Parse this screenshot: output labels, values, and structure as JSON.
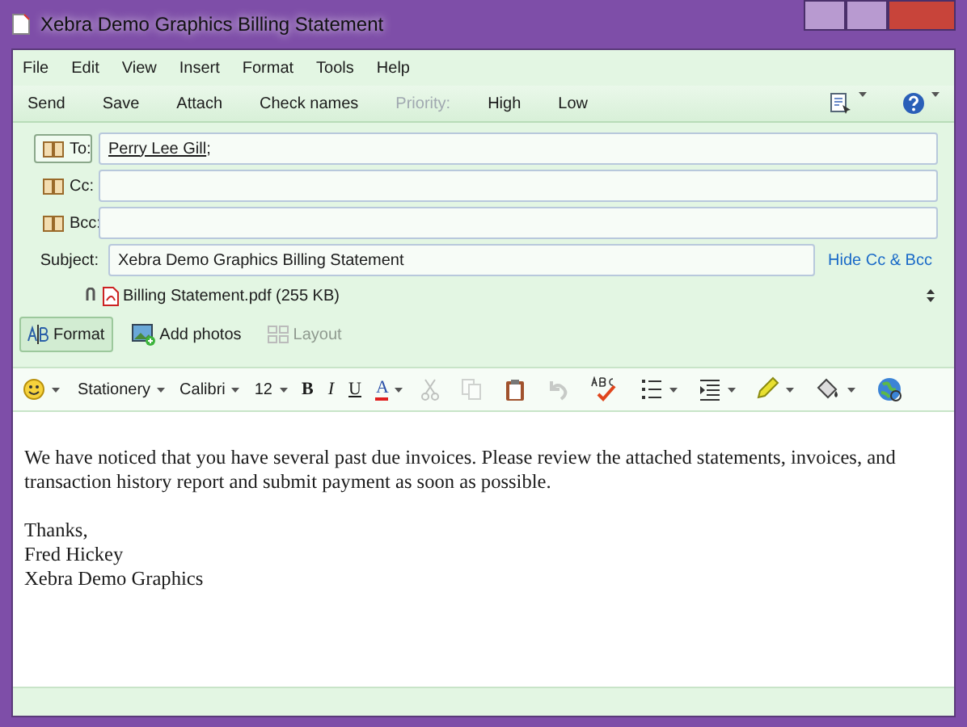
{
  "window": {
    "title": "Xebra Demo Graphics Billing Statement"
  },
  "menu": [
    "File",
    "Edit",
    "View",
    "Insert",
    "Format",
    "Tools",
    "Help"
  ],
  "toolbar": [
    {
      "label": "Send",
      "disabled": false
    },
    {
      "label": "Save",
      "disabled": false
    },
    {
      "label": "Attach",
      "disabled": false
    },
    {
      "label": "Check names",
      "disabled": false
    },
    {
      "label": "Priority:",
      "disabled": true
    },
    {
      "label": "High",
      "disabled": false
    },
    {
      "label": "Low",
      "disabled": false
    }
  ],
  "recipients": [
    {
      "label": "To:",
      "selected": true,
      "value": "Perry Lee Gill",
      "separator": ";"
    },
    {
      "label": "Cc:",
      "selected": false
    },
    {
      "label": "Bcc:",
      "selected": false
    }
  ],
  "subject": {
    "label": "Subject:",
    "value": "Xebra Demo Graphics Billing Statement"
  },
  "hide_link": "Hide Cc & Bcc",
  "attachment": {
    "name": "Billing Statement.pdf (255 KB)"
  },
  "view_buttons": [
    {
      "label": "Format",
      "selected": true,
      "disabled": false
    },
    {
      "label": "Add photos",
      "selected": false,
      "disabled": false
    },
    {
      "label": "Layout",
      "selected": false,
      "disabled": true
    }
  ],
  "format_toolbar": [
    {
      "kind": "icon",
      "disabled": false,
      "dropdown": true
    },
    {
      "kind": "dropdown",
      "label": "Stationery"
    },
    {
      "kind": "dropdown",
      "label": "Calibri"
    },
    {
      "kind": "dropdown",
      "label": "12"
    },
    {
      "kind": "style",
      "label": "B"
    },
    {
      "kind": "style",
      "label": "I"
    },
    {
      "kind": "style",
      "label": "U"
    },
    {
      "kind": "style",
      "label": "A",
      "dropdown": true
    },
    {
      "kind": "icon",
      "disabled": true,
      "dropdown": false
    },
    {
      "kind": "icon",
      "disabled": true,
      "dropdown": false
    },
    {
      "kind": "icon",
      "disabled": false,
      "dropdown": false
    },
    {
      "kind": "icon",
      "disabled": true,
      "dropdown": false
    },
    {
      "kind": "icon",
      "disabled": false,
      "dropdown": false
    },
    {
      "kind": "icon",
      "disabled": false,
      "dropdown": true
    },
    {
      "kind": "icon",
      "disabled": false,
      "dropdown": true
    },
    {
      "kind": "icon",
      "disabled": false,
      "dropdown": true
    },
    {
      "kind": "icon",
      "disabled": false,
      "dropdown": true
    },
    {
      "kind": "icon",
      "disabled": false,
      "dropdown": false
    }
  ],
  "body": [
    "We have noticed that you have several past due invoices.  Please review the attached statements, invoices, and transaction history report and submit payment as soon as possible.",
    "Thanks,\nFred Hickey\nXebra Demo Graphics"
  ]
}
